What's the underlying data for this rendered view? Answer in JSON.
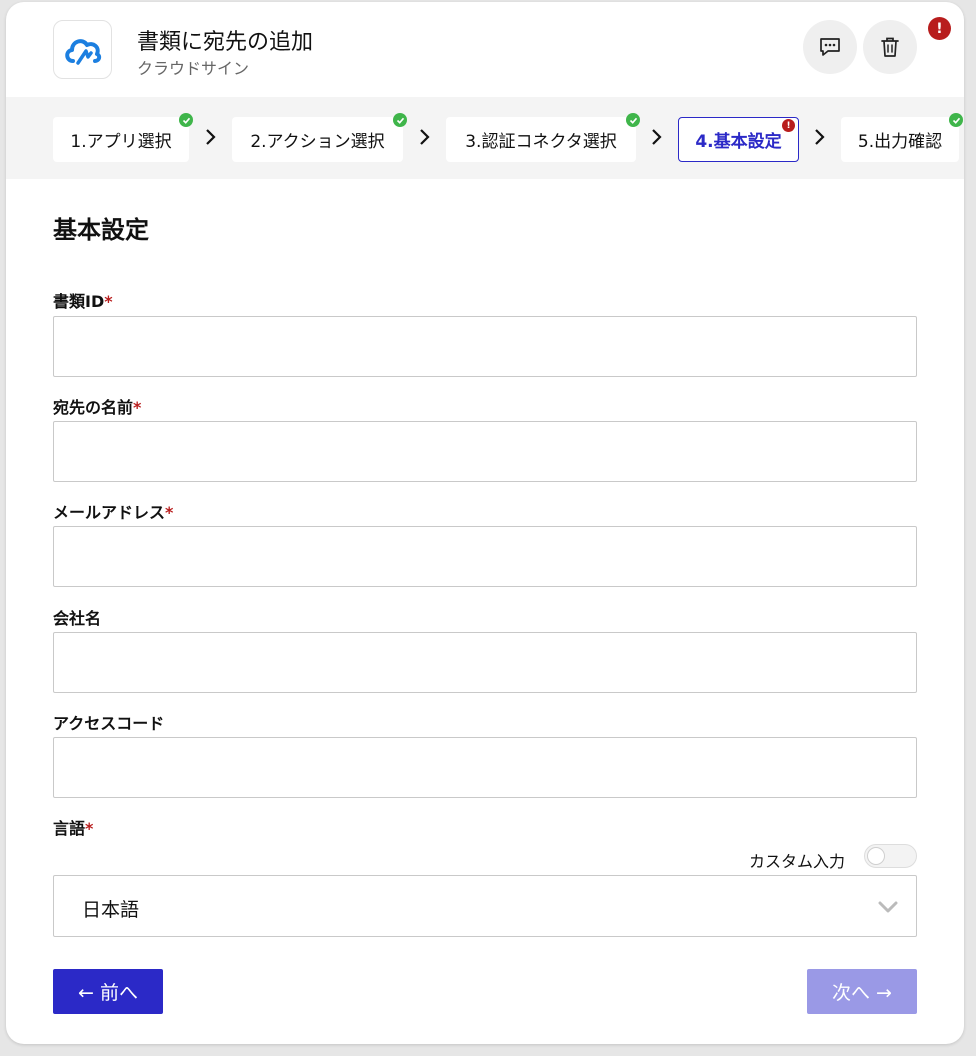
{
  "header": {
    "title": "書類に宛先の追加",
    "subtitle": "クラウドサイン",
    "app_icon": "cloud-sign-logo",
    "actions": [
      {
        "name": "comment",
        "icon": "chat-bubble-icon"
      },
      {
        "name": "delete",
        "icon": "trash-icon"
      }
    ],
    "error_badge": "!"
  },
  "steps": [
    {
      "label": "1.アプリ選択",
      "status": "done"
    },
    {
      "label": "2.アクション選択",
      "status": "done"
    },
    {
      "label": "3.認証コネクタ選択",
      "status": "done"
    },
    {
      "label": "4.基本設定",
      "status": "error",
      "badge": "!"
    },
    {
      "label": "5.出力確認",
      "status": "done"
    }
  ],
  "section_title": "基本設定",
  "fields": {
    "document_id": {
      "label": "書類ID",
      "required": "*",
      "value": ""
    },
    "recipient_name": {
      "label": "宛先の名前",
      "required": "*",
      "value": ""
    },
    "email": {
      "label": "メールアドレス",
      "required": "*",
      "value": ""
    },
    "company": {
      "label": "会社名",
      "value": ""
    },
    "access_code": {
      "label": "アクセスコード",
      "value": ""
    },
    "language": {
      "label": "言語",
      "required": "*",
      "value": "日本語"
    }
  },
  "custom_input": {
    "label": "カスタム入力",
    "enabled": false
  },
  "buttons": {
    "prev": "← 前へ",
    "next": "次へ →"
  },
  "colors": {
    "primary": "#2b29c7",
    "primary_disabled": "#9a99e6",
    "error": "#b81d1d",
    "success": "#3fb54a"
  }
}
